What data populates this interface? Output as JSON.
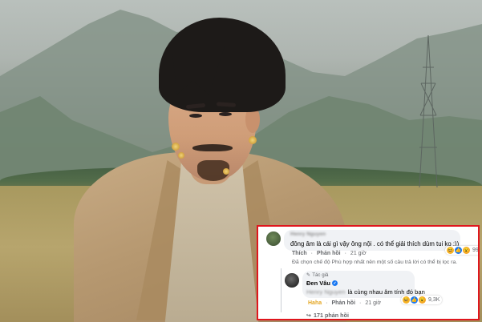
{
  "comment_thread": {
    "comment": {
      "author": "Henry Nguyen",
      "text": "đông âm là cái gì vậy ông nội . có thể giải thích dùm tui ko :))",
      "reaction_count": "993",
      "like_label": "Thích",
      "reply_label": "Phản hồi",
      "time": "21 giờ",
      "filter_note": "Đã chọn chế độ Phù hợp nhất nên một số câu trả lời có thể bị lọc ra."
    },
    "reply": {
      "badge": "Tác giả",
      "author": "Đen Vâu",
      "mention": "Henry Nguyen",
      "text": "là cùng nhau âm tính đó bạn",
      "reaction_count": "9,3K",
      "reacted_label": "Haha",
      "reply_label": "Phản hồi",
      "time": "21 giờ"
    },
    "more_replies": "171 phản hồi"
  },
  "colors": {
    "highlight_border": "#e0161d",
    "bubble_bg": "#f0f2f5",
    "verified": "#1877f2",
    "haha": "#f7b125"
  },
  "icons": [
    "haha-icon",
    "like-icon",
    "wow-icon",
    "pencil-icon",
    "verified-icon",
    "reply-arrow-icon"
  ]
}
